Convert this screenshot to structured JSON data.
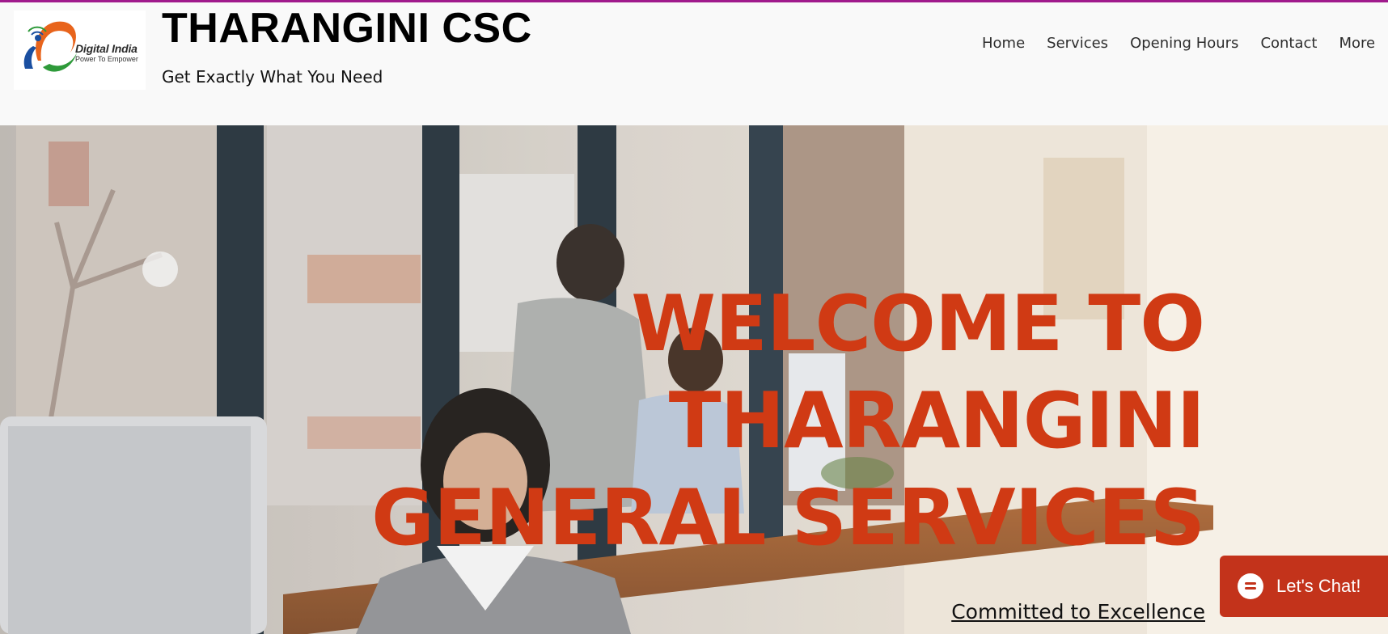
{
  "header": {
    "logo": {
      "line1": "Digital India",
      "line2": "Power To Empower"
    },
    "title": "THARANGINI CSC",
    "tagline": "Get Exactly What You Need"
  },
  "nav": {
    "items": [
      {
        "label": "Home"
      },
      {
        "label": "Services"
      },
      {
        "label": "Opening Hours"
      },
      {
        "label": "Contact"
      },
      {
        "label": "More"
      }
    ]
  },
  "hero": {
    "heading_lines": [
      "WELCOME TO",
      "THARANGINI",
      "GENERAL SERVICES"
    ],
    "subtext": "Committed to Excellence"
  },
  "chat": {
    "label": "Let's Chat!",
    "icon": "chat-bubble-icon"
  },
  "colors": {
    "accent_line": "#a01a8c",
    "hero_heading": "#d03a14",
    "chat_button": "#c3331b"
  }
}
